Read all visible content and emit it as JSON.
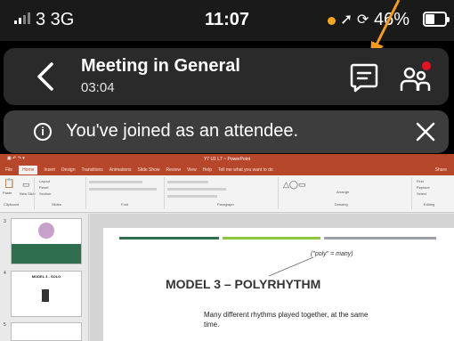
{
  "status_bar": {
    "carrier": "3 3G",
    "time": "11:07",
    "battery_percent": "46%",
    "battery_level": 0.45,
    "icons": [
      "signal-icon",
      "recording-dot-icon",
      "location-icon",
      "orientation-lock-icon",
      "battery-icon"
    ]
  },
  "meeting": {
    "title": "Meeting in General",
    "elapsed": "03:04",
    "accent": "#f5a623",
    "badge_color": "#e81123",
    "icons": [
      "back-icon",
      "chat-icon",
      "participants-icon"
    ]
  },
  "banner": {
    "text": "You've joined as an attendee.",
    "icons": [
      "info-icon",
      "close-icon"
    ]
  },
  "powerpoint": {
    "title": "Y7 U1 L7 ~ PowerPoint",
    "tabs": [
      "File",
      "Home",
      "Insert",
      "Design",
      "Transitions",
      "Animations",
      "Slide Show",
      "Review",
      "View",
      "Help",
      "Tell me what you want to do"
    ],
    "active_tab": "Home",
    "share": "Share",
    "groups": [
      "Clipboard",
      "Slides",
      "Font",
      "Paragraph",
      "Drawing",
      "Editing"
    ],
    "ribbon_commands": [
      "Paste",
      "New Slide",
      "Layout",
      "Reset",
      "Section",
      "Find",
      "Replace",
      "Select",
      "Arrange"
    ],
    "thumbnails": [
      {
        "num": "3"
      },
      {
        "num": "4",
        "title": "MODEL 3 - SOLO"
      },
      {
        "num": "5"
      }
    ],
    "slide": {
      "note": "(\"poly\" = many)",
      "heading": "MODEL 3 – POLYRHYTHM",
      "body": "Many different rhythms played together, at the same time."
    },
    "brand_color": "#b7472a"
  }
}
